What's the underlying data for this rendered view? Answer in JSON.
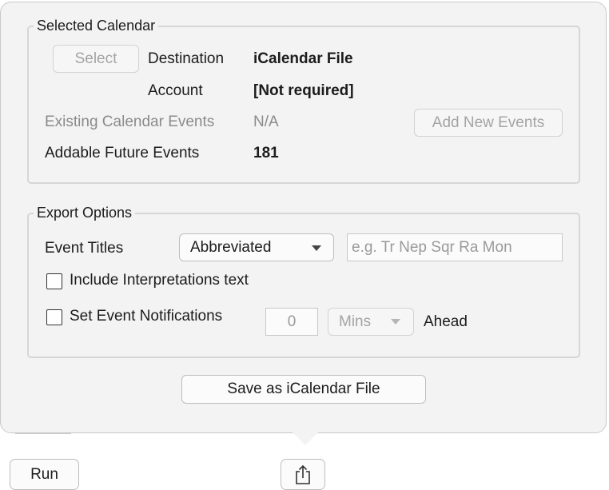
{
  "selected_calendar": {
    "legend": "Selected Calendar",
    "select_button": "Select",
    "destination_label": "Destination",
    "destination_value": "iCalendar File",
    "account_label": "Account",
    "account_value": "[Not required]",
    "existing_label": "Existing Calendar Events",
    "existing_value": "N/A",
    "add_new_button": "Add New Events",
    "addable_label": "Addable Future Events",
    "addable_value": "181"
  },
  "export_options": {
    "legend": "Export Options",
    "event_titles_label": "Event Titles",
    "event_titles_value": "Abbreviated",
    "example_placeholder": "e.g. Tr Nep Sqr Ra Mon",
    "include_interpretations_label": "Include Interpretations text",
    "include_interpretations_checked": false,
    "set_notifications_label": "Set Event Notifications",
    "set_notifications_checked": false,
    "notification_amount": "0",
    "notification_unit": "Mins",
    "ahead_label": "Ahead"
  },
  "save_button": "Save as iCalendar File",
  "bottom": {
    "run_button": "Run",
    "share_icon": "share-icon"
  }
}
